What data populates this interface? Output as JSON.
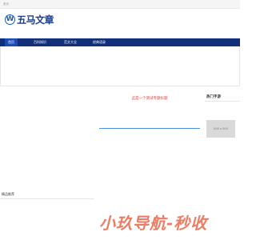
{
  "topbar": {
    "text": "首页"
  },
  "logo": {
    "mark": "W",
    "text": "五马文章"
  },
  "nav": {
    "items": [
      "首页",
      "百科知识",
      "范文大全",
      "经典语录"
    ]
  },
  "headline": {
    "text": "这是一个测试专题标题"
  },
  "hot": {
    "title": "热门手游",
    "thumb_label": "000 x 000"
  },
  "featured": {
    "title": "精品推荐"
  },
  "watermark": {
    "text": "小玖导航-秒收"
  },
  "colors": {
    "nav_bg": "#12307a",
    "nav_active": "#1c4bb5",
    "headline": "#e03a3a",
    "accent_line": "#4a8fe0"
  }
}
